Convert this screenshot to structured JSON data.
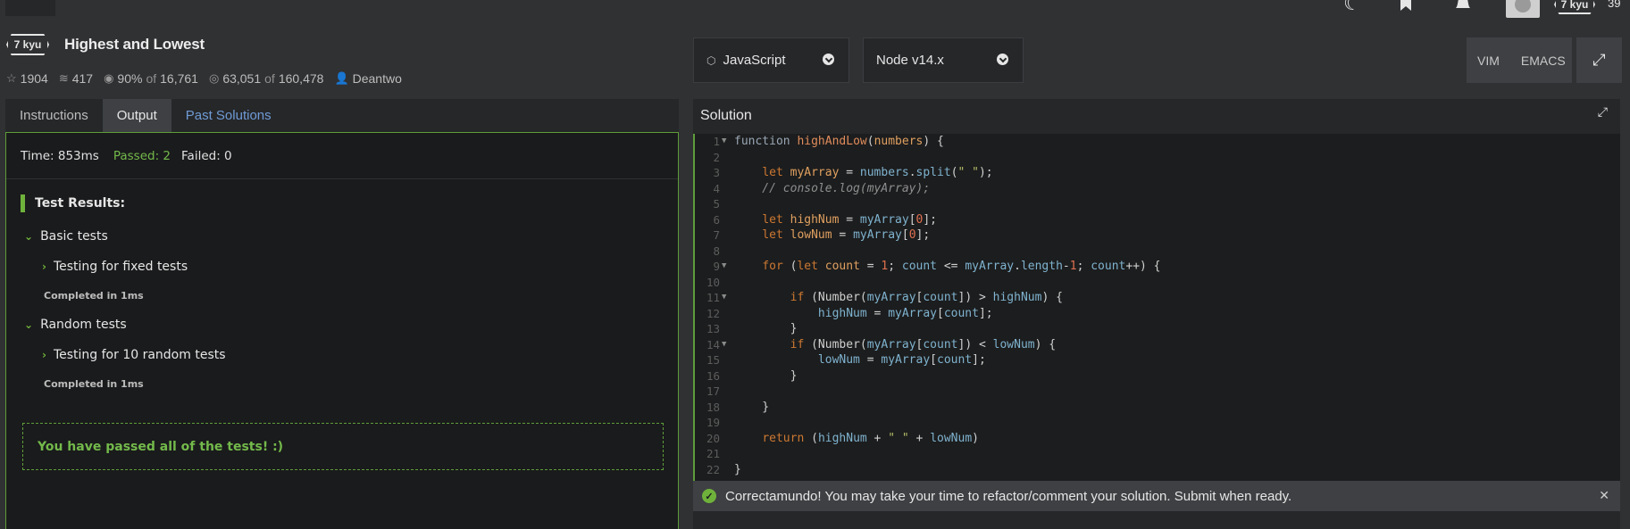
{
  "top_nav": {
    "rank_badge": "7 kyu",
    "honor_count": "39"
  },
  "kata": {
    "rank": "7 kyu",
    "title": "Highest and Lowest",
    "stats": {
      "stars": "1904",
      "collections": "417",
      "satisfaction": "90%",
      "of_word_1": "of",
      "votes": "16,761",
      "completed": "63,051",
      "of_word_2": "of",
      "attempts": "160,478",
      "author": "Deantwo"
    }
  },
  "toolbar": {
    "language": "JavaScript",
    "version": "Node v14.x",
    "modes": [
      "VIM",
      "EMACS"
    ]
  },
  "left_tabs": [
    "Instructions",
    "Output",
    "Past Solutions"
  ],
  "output": {
    "time": "Time: 853ms",
    "passed": "Passed: 2",
    "failed": "Failed: 0",
    "results_title": "Test Results:",
    "groups": [
      {
        "name": "Basic tests",
        "test": "Testing for fixed tests",
        "completed": "Completed in 1ms"
      },
      {
        "name": "Random tests",
        "test": "Testing for 10 random tests",
        "completed": "Completed in 1ms"
      }
    ],
    "pass_message": "You have passed all of the tests! :)"
  },
  "solution": {
    "title": "Solution",
    "line_numbers": [
      "1",
      "2",
      "3",
      "4",
      "5",
      "6",
      "7",
      "8",
      "9",
      "10",
      "11",
      "12",
      "13",
      "14",
      "15",
      "16",
      "17",
      "18",
      "19",
      "20",
      "21",
      "22"
    ],
    "success_message": "Correctamundo! You may take your time to refactor/comment your solution. Submit when ready."
  },
  "icons": {
    "top": [
      "moon-icon",
      "bookmark-icon",
      "bell-icon"
    ],
    "stats": [
      "star-icon",
      "collection-icon",
      "eye-icon",
      "target-icon",
      "user-icon"
    ]
  },
  "colors": {
    "accent_green": "#6fb23b",
    "link_blue": "#6f9bd6"
  }
}
